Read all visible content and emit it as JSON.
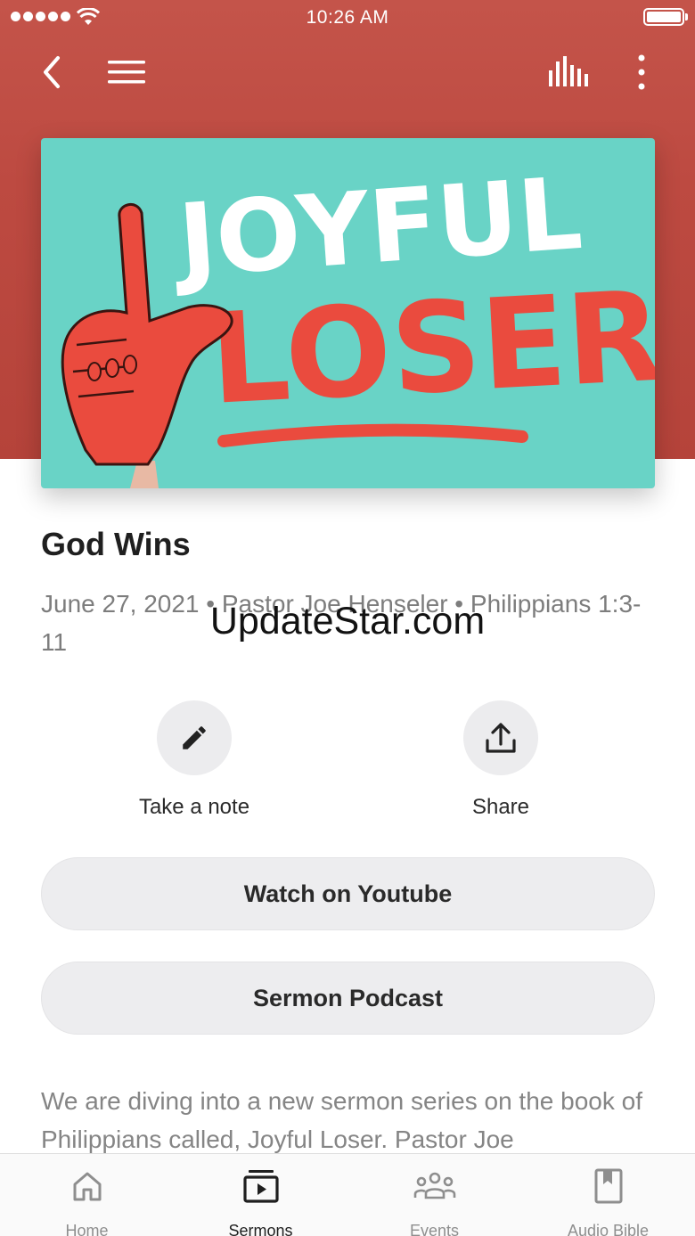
{
  "status_bar": {
    "time": "10:26 AM"
  },
  "nav": {
    "back_icon": "chevron-left-icon",
    "menu_icon": "hamburger-menu-icon",
    "audio_icon": "audio-bars-icon",
    "more_icon": "more-vertical-icon"
  },
  "artwork": {
    "line1": "JOYFUL",
    "line2": "LOSER"
  },
  "sermon": {
    "title": "God Wins",
    "meta": "June 27, 2021 • Pastor Joe Henseler • Philippians 1:3-11"
  },
  "watermark": "UpdateStar.com",
  "actions": [
    {
      "label": "Take a note",
      "icon": "pencil-icon"
    },
    {
      "label": "Share",
      "icon": "share-upload-icon"
    }
  ],
  "buttons": {
    "youtube": "Watch on Youtube",
    "podcast": "Sermon Podcast"
  },
  "description": "We are diving into a new sermon series on the book of Philippians called, Joyful Loser. Pastor Joe",
  "tabs": [
    {
      "label": "Home",
      "icon": "home-icon",
      "active": false
    },
    {
      "label": "Sermons",
      "icon": "sermons-play-icon",
      "active": true
    },
    {
      "label": "Events",
      "icon": "people-group-icon",
      "active": false
    },
    {
      "label": "Audio Bible",
      "icon": "book-bookmark-icon",
      "active": false
    }
  ],
  "colors": {
    "header_red": "#bd4a41",
    "artwork_teal": "#69d3c6",
    "artwork_red": "#ea4b3e",
    "pill_gray": "#ededef"
  }
}
